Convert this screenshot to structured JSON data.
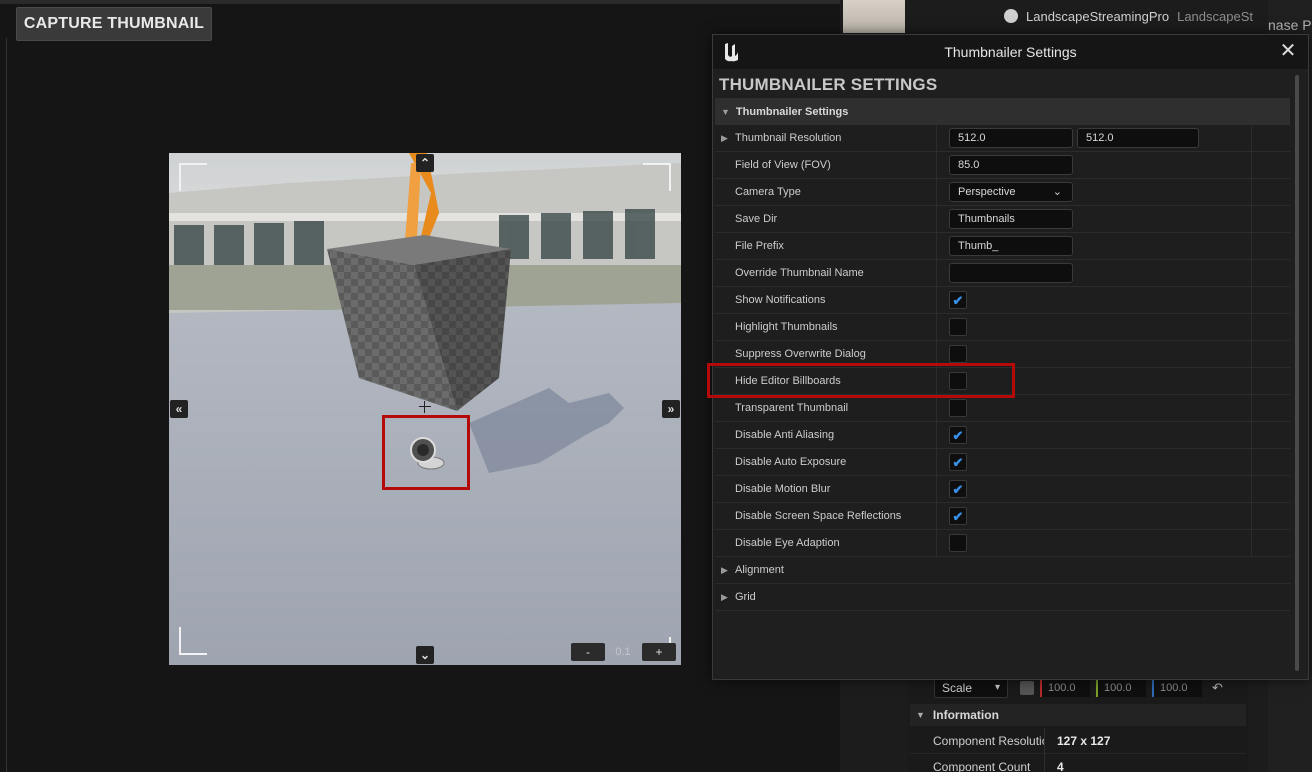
{
  "viewport": {
    "capture_button_label": "CAPTURE THUMBNAIL",
    "nav_up_glyph": "⌃",
    "nav_down_glyph": "⌄",
    "nav_left_glyph": "«",
    "nav_right_glyph": "»",
    "zoom_minus_label": "-",
    "zoom_value": "0.1",
    "zoom_plus_label": "+"
  },
  "background_editor": {
    "outliner_row": {
      "name": "LandscapeStreamingPro",
      "type": "LandscapeSt"
    },
    "edge_text": "nase P",
    "transform": {
      "mode": "Scale",
      "x": "100.0",
      "y": "100.0",
      "z": "100.0",
      "reset_glyph": "↶"
    },
    "information_section": "Information",
    "properties": [
      {
        "key": "Component Resolution",
        "value": "127 x 127"
      },
      {
        "key": "Component Count",
        "value": "4"
      }
    ]
  },
  "dialog": {
    "title": "Thumbnailer Settings",
    "close_glyph": "✕",
    "heading": "THUMBNAILER SETTINGS",
    "section": "Thumbnailer Settings",
    "resolution": {
      "label": "Thumbnail Resolution",
      "x": "512.0",
      "y": "512.0"
    },
    "fov": {
      "label": "Field of View (FOV)",
      "value": "85.0"
    },
    "camera_type": {
      "label": "Camera Type",
      "value": "Perspective",
      "chevron": "⌄"
    },
    "save_dir": {
      "label": "Save Dir",
      "value": "Thumbnails"
    },
    "file_prefix": {
      "label": "File Prefix",
      "value": "Thumb_"
    },
    "override_name": {
      "label": "Override Thumbnail Name",
      "value": ""
    },
    "checkboxes": [
      {
        "label": "Show Notifications",
        "checked": true
      },
      {
        "label": "Highlight Thumbnails",
        "checked": false
      },
      {
        "label": "Suppress Overwrite Dialog",
        "checked": false
      },
      {
        "label": "Hide Editor Billboards",
        "checked": false
      },
      {
        "label": "Transparent Thumbnail",
        "checked": false
      },
      {
        "label": "Disable Anti Aliasing",
        "checked": true
      },
      {
        "label": "Disable Auto Exposure",
        "checked": true
      },
      {
        "label": "Disable Motion Blur",
        "checked": true
      },
      {
        "label": "Disable Screen Space Reflections",
        "checked": true
      },
      {
        "label": "Disable Eye Adaption",
        "checked": false
      }
    ],
    "groups": [
      "Alignment",
      "Grid"
    ]
  },
  "colors": {
    "highlight": "#b40a0a",
    "check_accent": "#3a8fe8"
  }
}
